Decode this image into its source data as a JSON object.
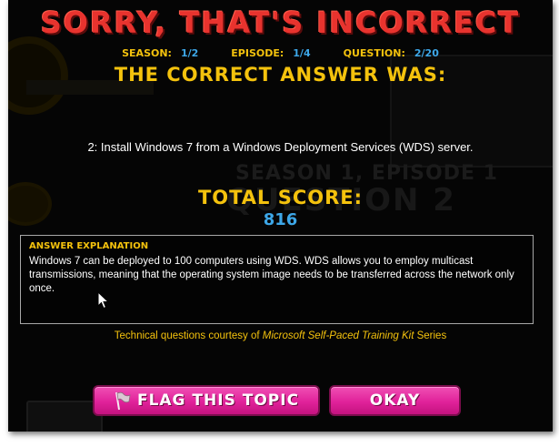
{
  "title": "SORRY, THAT'S INCORRECT",
  "meta": {
    "season_label": "SEASON:",
    "season_value": "1/2",
    "episode_label": "EPISODE:",
    "episode_value": "1/4",
    "question_label": "QUESTION:",
    "question_value": "2/20"
  },
  "correct_heading": "THE CORRECT ANSWER WAS:",
  "correct_answer": "2: Install Windows 7 from a Windows Deployment Services (WDS) server.",
  "score": {
    "label": "TOTAL SCORE:",
    "value": "816"
  },
  "explanation": {
    "heading": "ANSWER EXPLANATION",
    "text": "Windows 7 can be deployed to 100 computers using WDS. WDS allows you to employ multicast transmissions, meaning that the operating system image needs to be transferred across the network only once."
  },
  "credits": {
    "prefix": "Technical questions courtesy of ",
    "source": "Microsoft Self-Paced Training Kit",
    "suffix": " Series"
  },
  "buttons": {
    "flag_label": "FLAG THIS TOPIC",
    "okay_label": "OKAY"
  },
  "background": {
    "ghost_top": "SEASON 1, EPISODE 1",
    "ghost_bottom": "QUESTION 2"
  },
  "colors": {
    "title_red": "#e8332e",
    "accent_yellow": "#f4c20d",
    "accent_blue": "#3da7e8",
    "button_pink": "#e0229a",
    "background": "#050505"
  },
  "icons": {
    "flag": "flag-icon",
    "cursor": "mouse-pointer-icon"
  }
}
